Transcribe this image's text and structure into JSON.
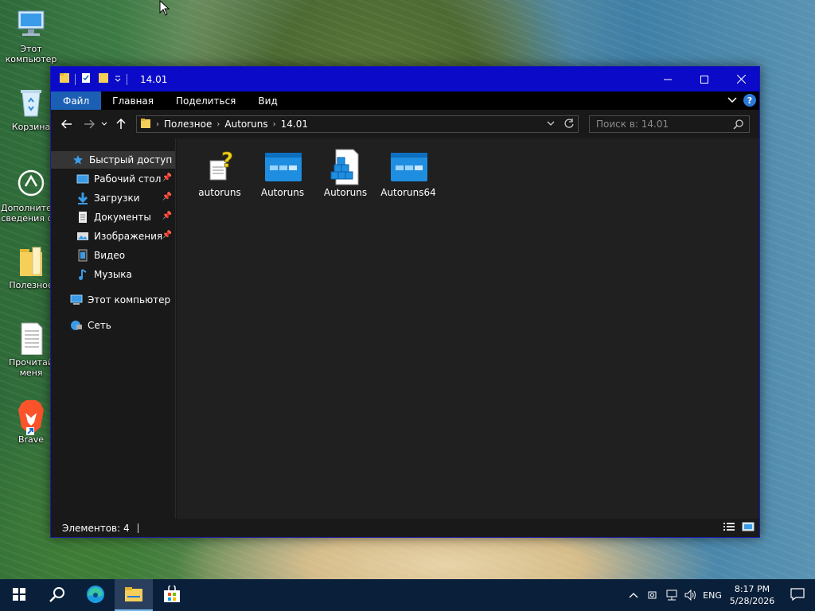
{
  "desktop": {
    "icons": [
      {
        "label": "Этот\nкомпьютер",
        "icon": "computer-icon"
      },
      {
        "label": "Корзина",
        "icon": "recycle-bin-icon"
      },
      {
        "label": "Дополнительные сведения о...",
        "icon": "info-icon"
      },
      {
        "label": "Полезное",
        "icon": "folder-icon"
      },
      {
        "label": "Прочитай меня",
        "icon": "text-document-icon"
      },
      {
        "label": "Brave",
        "icon": "brave-icon"
      }
    ]
  },
  "window": {
    "title": "14.01",
    "ribbon_tabs": [
      "Файл",
      "Главная",
      "Поделиться",
      "Вид"
    ],
    "breadcrumb": [
      "Полезное",
      "Autoruns",
      "14.01"
    ],
    "search_placeholder": "Поиск в: 14.01",
    "nav_pane": {
      "quick_access": "Быстрый доступ",
      "pinned": [
        {
          "label": "Рабочий стол",
          "icon": "desktop-icon",
          "pinned": true
        },
        {
          "label": "Загрузки",
          "icon": "downloads-icon",
          "pinned": true
        },
        {
          "label": "Документы",
          "icon": "documents-icon",
          "pinned": true
        },
        {
          "label": "Изображения",
          "icon": "pictures-icon",
          "pinned": true
        },
        {
          "label": "Видео",
          "icon": "videos-icon",
          "pinned": false
        },
        {
          "label": "Музыка",
          "icon": "music-icon",
          "pinned": false
        }
      ],
      "this_pc": "Этот компьютер",
      "network": "Сеть"
    },
    "files": [
      {
        "name": "autoruns",
        "icon": "help-file-icon"
      },
      {
        "name": "Autoruns",
        "icon": "app-window-icon"
      },
      {
        "name": "Autoruns",
        "icon": "registry-file-icon"
      },
      {
        "name": "Autoruns64",
        "icon": "app-window-icon"
      }
    ],
    "status": "Элементов: 4"
  },
  "taskbar": {
    "apps": [
      "start-icon",
      "search-icon",
      "edge-icon",
      "file-explorer-icon",
      "store-icon"
    ],
    "active_app": "file-explorer-icon",
    "language": "ENG",
    "time": "8:17 PM",
    "date": "5/28/2026"
  },
  "colors": {
    "titlebar": "#0a0ac8",
    "file_tab": "#1a5fb4",
    "window_bg": "#191919",
    "content_bg": "#202020"
  }
}
